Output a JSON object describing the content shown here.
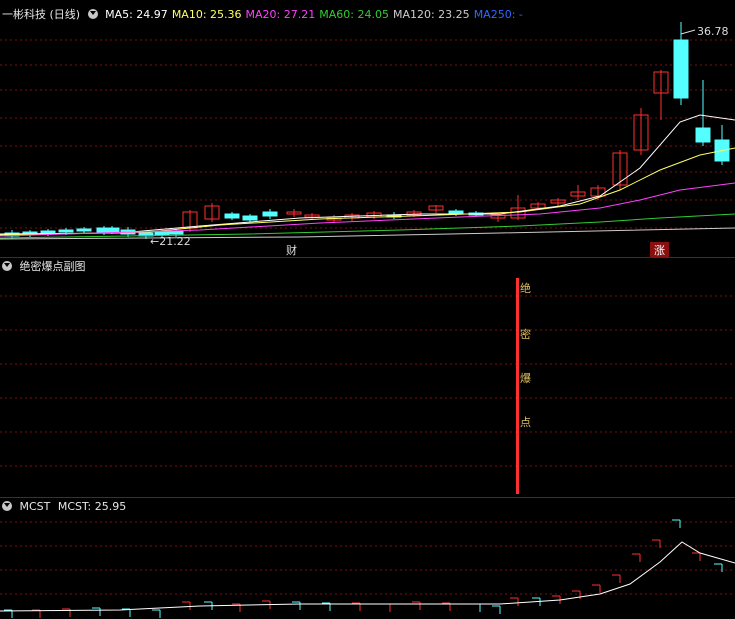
{
  "main": {
    "title": "一彬科技 (日线)",
    "ma": [
      {
        "label": "MA5:",
        "value": "24.97",
        "color": "#ffffff"
      },
      {
        "label": "MA10:",
        "value": "25.36",
        "color": "#ffff66"
      },
      {
        "label": "MA20:",
        "value": "27.21",
        "color": "#ff40ff"
      },
      {
        "label": "MA60:",
        "value": "24.05",
        "color": "#33cc33"
      },
      {
        "label": "MA120:",
        "value": "23.25",
        "color": "#cccccc"
      },
      {
        "label": "MA250:",
        "value": "-",
        "color": "#3366ff"
      }
    ],
    "high_label": "36.78",
    "low_label": "←21.22",
    "marker_cai": "财",
    "marker_zhang": "涨"
  },
  "sub1": {
    "title": "绝密爆点副图",
    "signal_chars": [
      "绝",
      "密",
      "爆",
      "点"
    ]
  },
  "sub2": {
    "title": "MCST",
    "value_label": "MCST: 25.95"
  },
  "colors": {
    "up": "#ff3030",
    "down": "#54ffff",
    "grid": "#7a1010",
    "border": "#8a1010"
  }
}
